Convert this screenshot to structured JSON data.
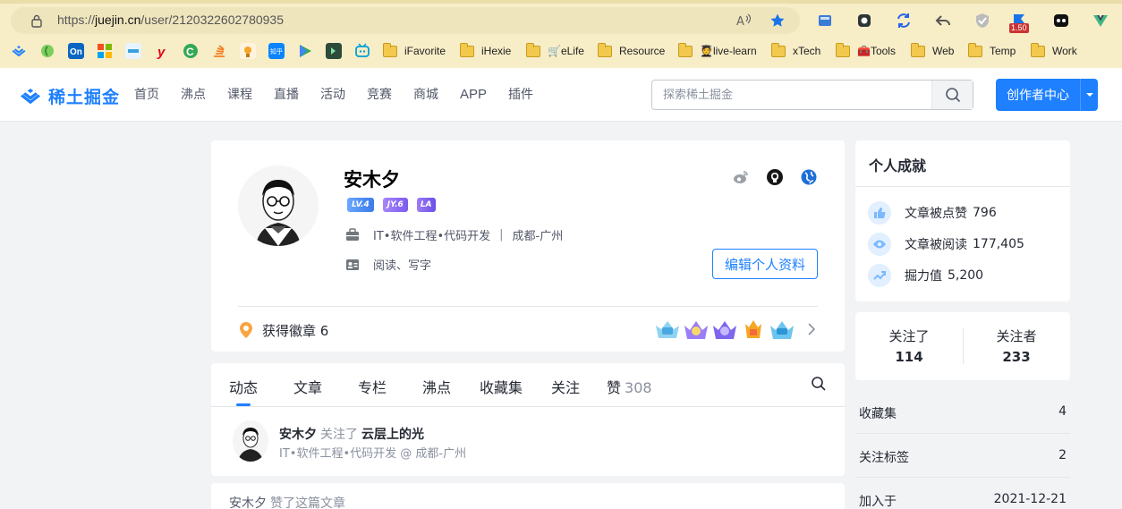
{
  "browser": {
    "url_prefix": "https://",
    "url_host": "juejin.cn",
    "url_path": "/user/2120322602780935",
    "download_badge": "1.50",
    "bookmarks": [
      "iFavorite",
      "iHexie",
      "🛒eLife",
      "Resource",
      "🧑‍🎓live-learn",
      "xTech",
      "🧰Tools",
      "Web",
      "Temp",
      "Work"
    ],
    "bookmark_icons": [
      "juejin-icon",
      "leaf-icon",
      "onenote-icon",
      "microsoft-icon",
      "weibo-icon",
      "yahoo-icon",
      "g-icon",
      "stack-icon",
      "trophy-icon",
      "zhihu-icon",
      "play-icon",
      "terminal-icon",
      "bilibili-icon"
    ]
  },
  "header": {
    "logo_text": "稀土掘金",
    "nav": [
      "首页",
      "沸点",
      "课程",
      "直播",
      "活动",
      "竞赛",
      "商城",
      "APP",
      "插件"
    ],
    "search_placeholder": "探索稀土掘金",
    "creator_button": "创作者中心"
  },
  "profile": {
    "name": "安木夕",
    "badges": [
      "LV.4",
      "JY.6",
      "LA"
    ],
    "position": "IT•软件工程•代码开发",
    "location": "成都-广州",
    "interests": "阅读、写字",
    "edit_button": "编辑个人资料",
    "medals_label": "获得徽章 6",
    "social_icons": [
      "weibo-icon",
      "github-icon",
      "globe-icon"
    ]
  },
  "tabs": {
    "items": [
      "动态",
      "文章",
      "专栏",
      "沸点",
      "收藏集",
      "关注",
      "赞"
    ],
    "like_count": "308",
    "active": "动态"
  },
  "feed": {
    "item1": {
      "name": "安木夕",
      "action": "关注了",
      "target": "云层上的光",
      "subtitle": "IT•软件工程•代码开发 @ 成都-广州"
    },
    "item2": {
      "name": "安木夕",
      "action": "赞了这篇文章"
    }
  },
  "achievements": {
    "title": "个人成就",
    "items": [
      {
        "label": "文章被点赞",
        "value": "796",
        "icon": "thumbs-up-icon"
      },
      {
        "label": "文章被阅读",
        "value": "177,405",
        "icon": "eye-icon"
      },
      {
        "label": "掘力值",
        "value": "5,200",
        "icon": "trend-icon"
      }
    ]
  },
  "follow": {
    "following_label": "关注了",
    "following": "114",
    "followers_label": "关注者",
    "followers": "233"
  },
  "stats": [
    {
      "label": "收藏集",
      "value": "4"
    },
    {
      "label": "关注标签",
      "value": "2"
    },
    {
      "label": "加入于",
      "value": "2021-12-21"
    }
  ],
  "colors": {
    "brand": "#1e80ff",
    "chrome": "#f7edc7"
  }
}
